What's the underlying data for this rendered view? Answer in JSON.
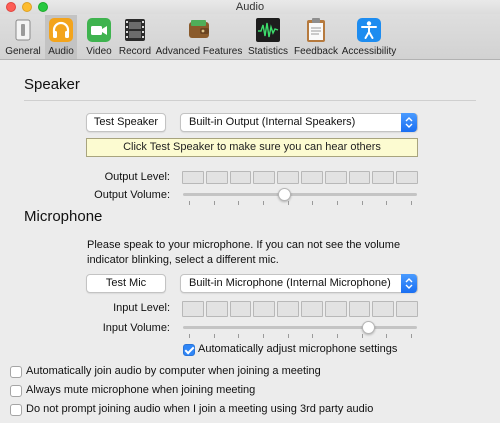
{
  "window": {
    "title": "Audio"
  },
  "toolbar": {
    "tabs": [
      {
        "label": "General",
        "icon": "general-icon"
      },
      {
        "label": "Audio",
        "icon": "headphones-icon",
        "selected": true
      },
      {
        "label": "Video",
        "icon": "video-camera-icon"
      },
      {
        "label": "Record",
        "icon": "film-icon"
      },
      {
        "label": "Advanced Features",
        "icon": "wallet-icon"
      },
      {
        "label": "Statistics",
        "icon": "waveform-icon"
      },
      {
        "label": "Feedback",
        "icon": "clipboard-icon"
      },
      {
        "label": "Accessibility",
        "icon": "accessibility-icon"
      }
    ]
  },
  "speaker": {
    "title": "Speaker",
    "test_button": "Test Speaker",
    "output_device": "Built-in Output (Internal Speakers)",
    "tooltip": "Click Test Speaker to make sure you can hear others",
    "output_level_label": "Output Level:",
    "output_volume_label": "Output Volume:",
    "output_volume_value": 0.43
  },
  "microphone": {
    "title": "Microphone",
    "instructions": "Please speak to your microphone. If you can not see the volume indicator blinking, select a different mic.",
    "test_button": "Test Mic",
    "input_device": "Built-in Microphone (Internal Microphone)",
    "input_level_label": "Input Level:",
    "input_volume_label": "Input Volume:",
    "input_volume_value": 0.81,
    "auto_adjust_label": "Automatically adjust microphone settings",
    "auto_adjust_checked": true
  },
  "options": [
    {
      "label": "Automatically join audio by computer when joining a meeting",
      "checked": false
    },
    {
      "label": "Always mute microphone when joining meeting",
      "checked": false
    },
    {
      "label": "Do not prompt joining audio when I join a meeting using 3rd party audio",
      "checked": false
    }
  ],
  "colors": {
    "accent_blue": "#2f86f7",
    "selected_tab_bg": "#c3c3c3",
    "tooltip_bg": "#fcfbd1"
  }
}
